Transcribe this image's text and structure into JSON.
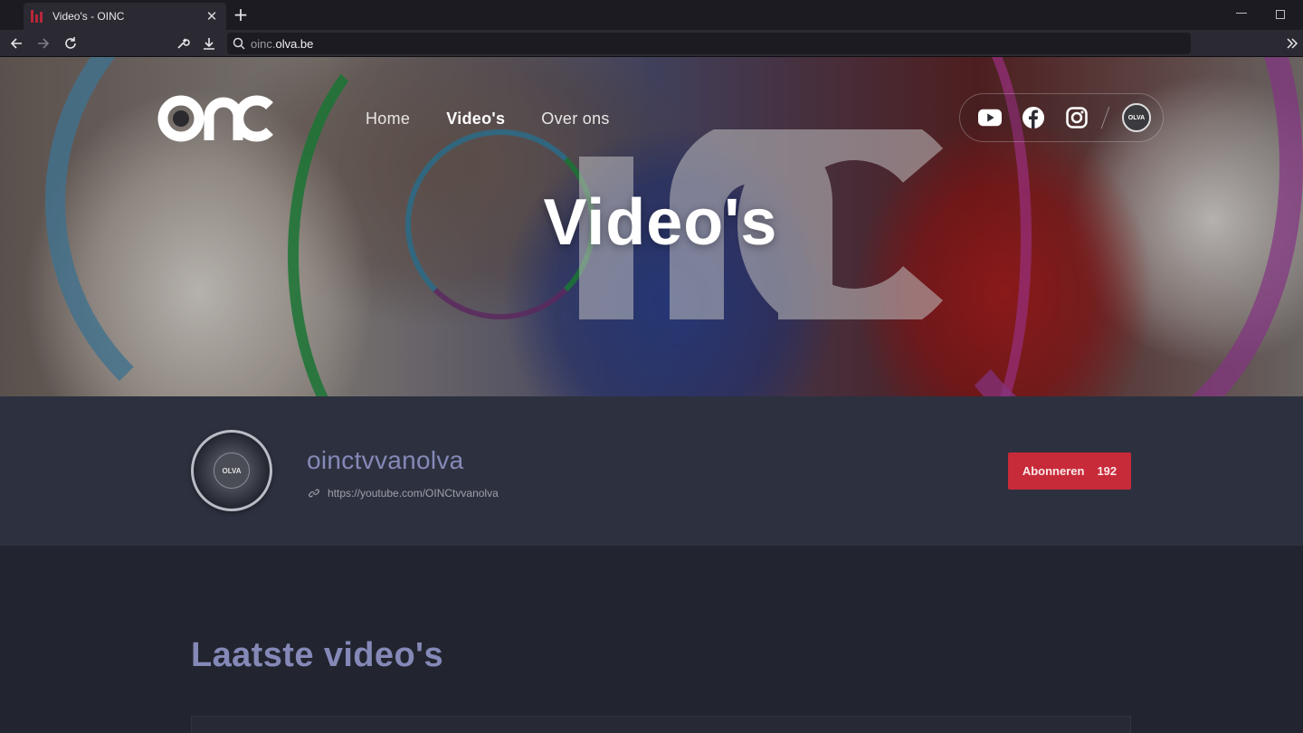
{
  "browser": {
    "tab_title": "Video's - OINC",
    "tab_close": "✕",
    "new_tab": "+",
    "url_prefix": "oinc.",
    "url_domain": "olva.be"
  },
  "site": {
    "logo_alt": "oinc",
    "nav": [
      {
        "label": "Home",
        "active": false
      },
      {
        "label": "Video's",
        "active": true
      },
      {
        "label": "Over ons",
        "active": false
      }
    ],
    "social_badge": "OLVA"
  },
  "hero": {
    "title": "Video's"
  },
  "channel": {
    "avatar_text": "OLVA",
    "name": "oinctvvanolva",
    "link": "https://youtube.com/OINCtvvanolva",
    "subscribe_label": "Abonneren",
    "subscriber_count": "192"
  },
  "latest": {
    "title": "Laatste video's"
  },
  "colors": {
    "accent_red": "#c72a39",
    "heading_lavender": "#8589b8",
    "channel_band": "#2d313f",
    "page_bg": "#22252f"
  }
}
